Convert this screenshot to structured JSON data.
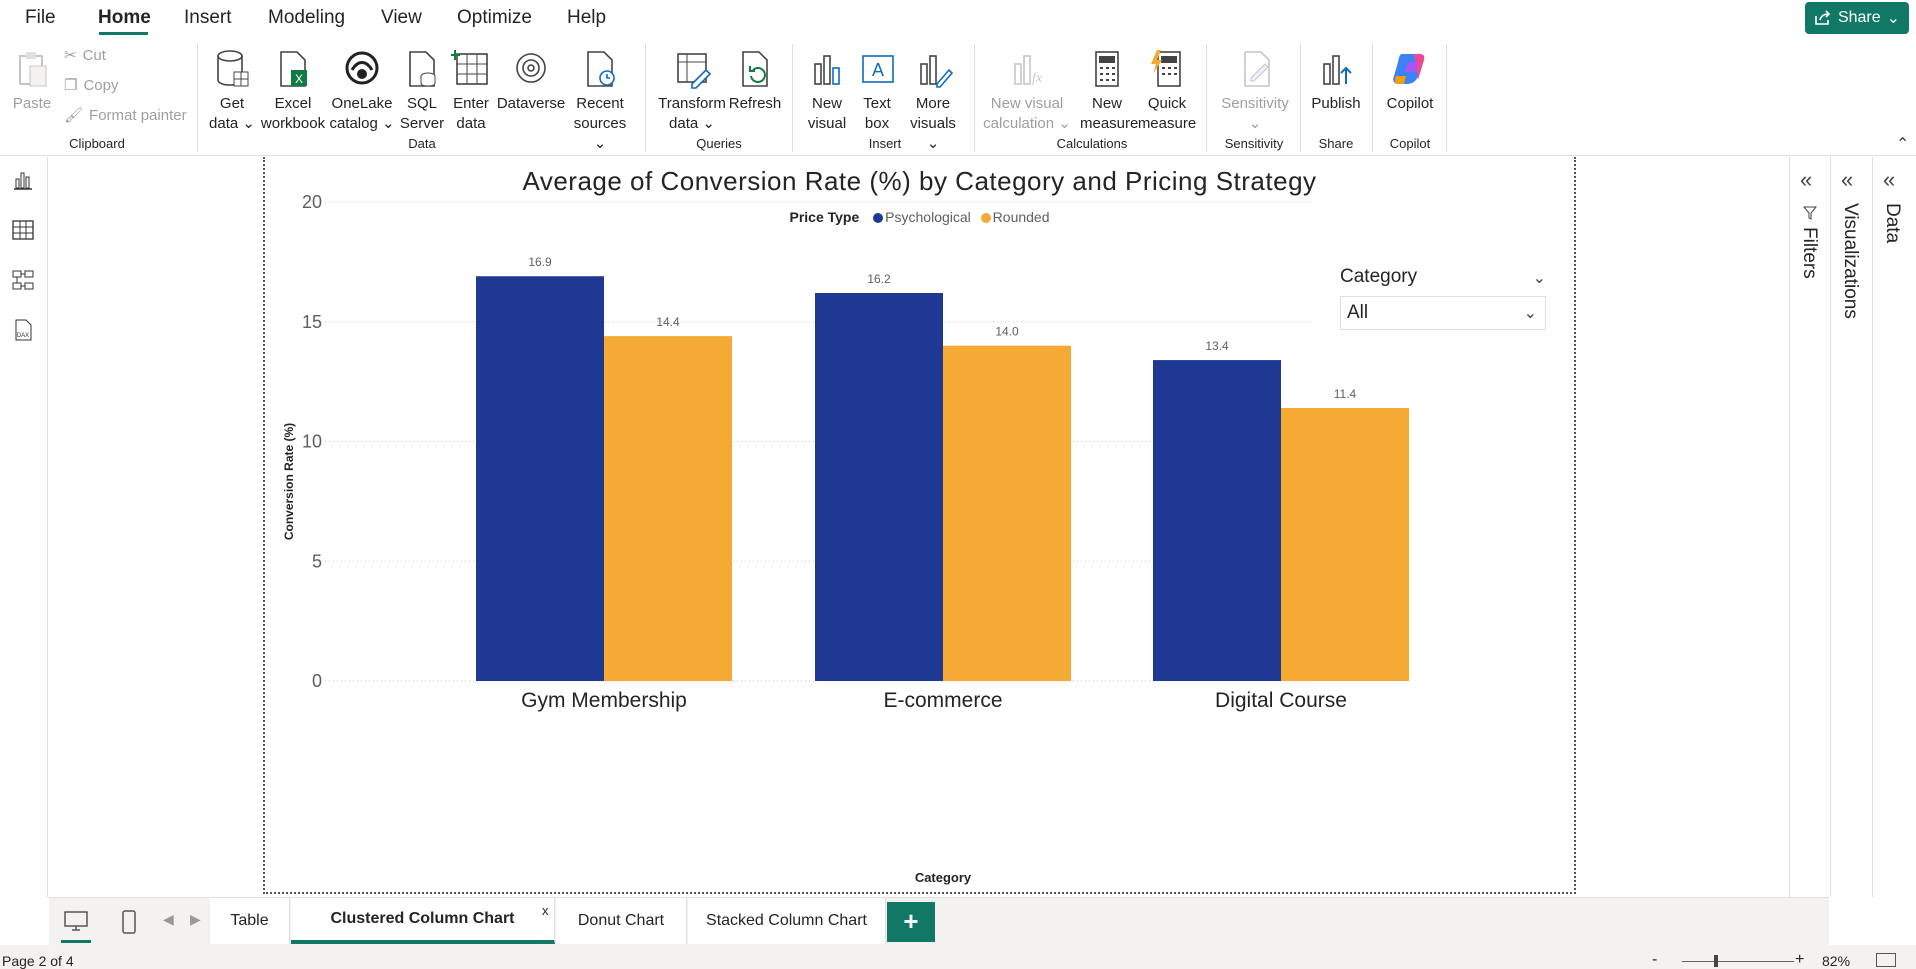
{
  "menu": {
    "items": [
      "File",
      "Home",
      "Insert",
      "Modeling",
      "View",
      "Optimize",
      "Help"
    ],
    "active": "Home",
    "share_label": "Share"
  },
  "ribbon": {
    "clipboard": {
      "paste": "Paste",
      "cut": "Cut",
      "copy": "Copy",
      "format_painter": "Format painter",
      "label": "Clipboard"
    },
    "data": {
      "get_data": [
        "Get",
        "data"
      ],
      "excel": [
        "Excel",
        "workbook"
      ],
      "onelake": [
        "OneLake",
        "catalog"
      ],
      "sql": [
        "SQL",
        "Server"
      ],
      "enter": [
        "Enter",
        "data"
      ],
      "dataverse": [
        "Dataverse",
        ""
      ],
      "recent": [
        "Recent",
        "sources"
      ],
      "label": "Data"
    },
    "queries": {
      "transform": [
        "Transform",
        "data"
      ],
      "refresh": [
        "Refresh",
        ""
      ],
      "label": "Queries"
    },
    "insert": {
      "new_visual": [
        "New",
        "visual"
      ],
      "text_box": [
        "Text",
        "box"
      ],
      "more_visuals": [
        "More",
        "visuals"
      ],
      "label": "Insert"
    },
    "calculations": {
      "new_visual_calc": [
        "New visual",
        "calculation"
      ],
      "new_measure": [
        "New",
        "measure"
      ],
      "quick_measure": [
        "Quick",
        "measure"
      ],
      "label": "Calculations"
    },
    "sensitivity": {
      "sensitivity": [
        "Sensitivity",
        ""
      ],
      "label": "Sensitivity"
    },
    "share": {
      "publish": [
        "Publish",
        ""
      ],
      "label": "Share"
    },
    "copilot": {
      "copilot": [
        "Copilot",
        ""
      ],
      "label": "Copilot"
    }
  },
  "chart_data": {
    "type": "bar",
    "title": "Average of Conversion Rate (%) by Category and Pricing Strategy",
    "legend_title": "Price Type",
    "legend_position": "top-center",
    "categories": [
      "Gym Membership",
      "E-commerce",
      "Digital Course"
    ],
    "series": [
      {
        "name": "Psychological",
        "color": "#1f3893",
        "values": [
          16.9,
          16.2,
          13.4
        ]
      },
      {
        "name": "Rounded",
        "color": "#f5aa36",
        "values": [
          14.4,
          14.0,
          11.4
        ]
      }
    ],
    "value_labels": [
      [
        "16.9",
        "16.2",
        "13.4"
      ],
      [
        "14.4",
        "14.0",
        "11.4"
      ]
    ],
    "xlabel": "Category",
    "ylabel": "Conversion Rate (%)",
    "ylim": [
      0,
      20
    ],
    "yticks": [
      0,
      5,
      10,
      15,
      20
    ],
    "grid": true
  },
  "slicer": {
    "title": "Category",
    "value": "All"
  },
  "panes": {
    "filters": "Filters",
    "visualizations": "Visualizations",
    "data": "Data"
  },
  "tabs": {
    "pages": [
      "Table",
      "Clustered Column Chart",
      "Donut Chart",
      "Stacked Column Chart"
    ],
    "active": "Clustered Column Chart",
    "close_glyph": "x",
    "add_glyph": "+"
  },
  "status": {
    "page": "Page 2 of 4",
    "zoom": "82%",
    "zoom_fraction": 0.3
  }
}
